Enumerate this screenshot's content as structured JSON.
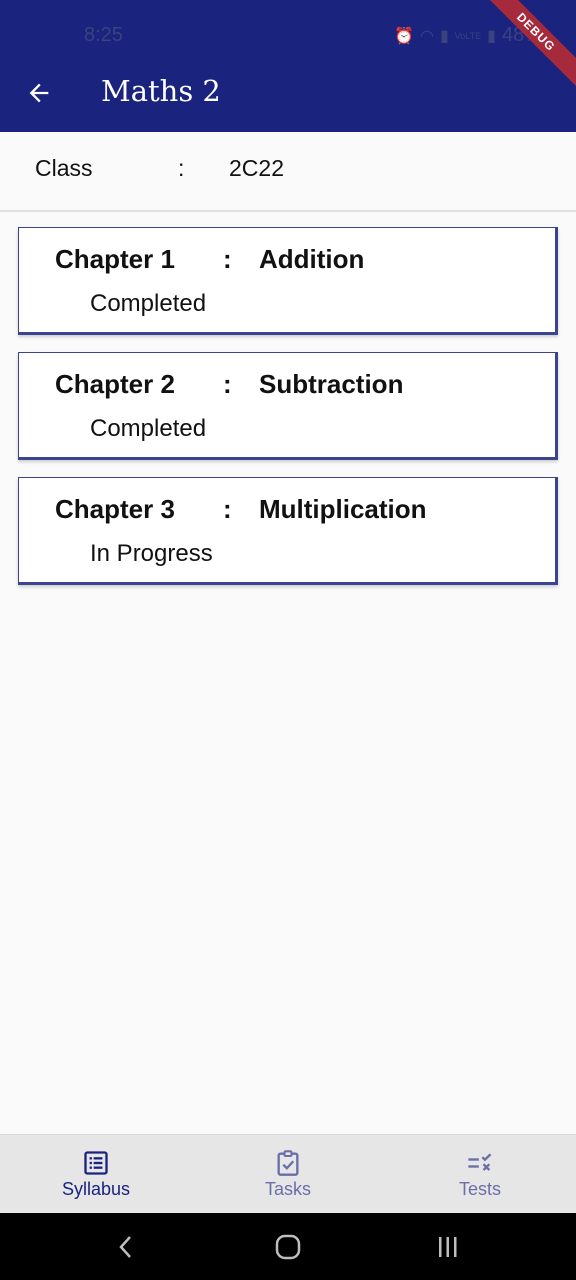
{
  "status_bar": {
    "time": "8:25",
    "battery": "48%",
    "network_label": "VoLTE"
  },
  "debug_banner": "DEBUG",
  "app_bar": {
    "title": "Maths 2",
    "back_icon": "arrow-back-icon"
  },
  "class_info": {
    "label": "Class",
    "separator": ":",
    "value": "2C22"
  },
  "chapters": [
    {
      "chapter": "Chapter 1",
      "separator": ":",
      "topic": "Addition",
      "status": "Completed"
    },
    {
      "chapter": "Chapter 2",
      "separator": ":",
      "topic": "Subtraction",
      "status": "Completed"
    },
    {
      "chapter": "Chapter 3",
      "separator": ":",
      "topic": "Multiplication",
      "status": "In Progress"
    }
  ],
  "bottom_nav": {
    "items": [
      {
        "label": "Syllabus",
        "icon": "list-icon",
        "active": true
      },
      {
        "label": "Tasks",
        "icon": "clipboard-check-icon",
        "active": false
      },
      {
        "label": "Tests",
        "icon": "checklist-icon",
        "active": false
      }
    ]
  },
  "colors": {
    "primary": "#1a237e",
    "card_border": "#3c4491",
    "inactive_nav": "#6a6fa8",
    "debug_ribbon": "#a52a3c"
  }
}
